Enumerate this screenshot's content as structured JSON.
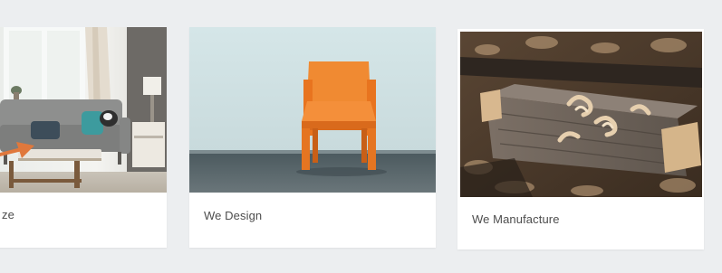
{
  "cards": [
    {
      "label": "ze",
      "image": "living-room-sofa-photo"
    },
    {
      "label": "We Design",
      "image": "orange-chair-photo"
    },
    {
      "label": "We Manufacture",
      "image": "wood-shavings-workbench-photo"
    }
  ],
  "icons": {
    "arrow": "arrow-right-icon"
  },
  "colors": {
    "page_bg": "#eceef0",
    "card_bg": "#ffffff",
    "label_text": "#4d4d4d",
    "chair": "#f07a27",
    "arrow": "#e0783c"
  }
}
